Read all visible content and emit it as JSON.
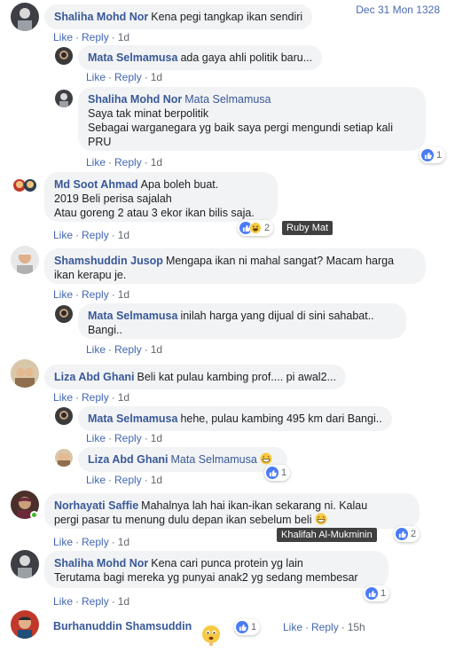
{
  "timestamp": "Dec 31 Mon 1328",
  "labels": {
    "like": "Like",
    "reply": "Reply",
    "dot": "·"
  },
  "comments": [
    {
      "author": "Shaliha Mohd Nor",
      "text": "Kena pegi tangkap ikan sendiri",
      "time": "1d"
    },
    {
      "author": "Mata Selmamusa",
      "text": "ada gaya ahli politik baru...",
      "time": "1d"
    },
    {
      "author": "Shaliha Mohd Nor",
      "mention": "Mata Selmamusa",
      "lines": [
        "Saya tak minat berpolitik",
        "Sebagai warganegara yg baik saya pergi mengundi setiap kali",
        "PRU"
      ],
      "time": "1d",
      "reaction_count": "1"
    },
    {
      "author": "Md Soot Ahmad",
      "text": "Apa boleh buat.",
      "lines": [
        "2019 Beli perisa sajalah",
        "Atau goreng 2 atau 3 ekor ikan bilis saja."
      ],
      "time": "1d",
      "reaction_count": "2",
      "hover_name": "Ruby Mat"
    },
    {
      "author": "Shamshuddin Jusop",
      "text": "Mengapa ikan ni mahal sangat? Macam harga",
      "lines": [
        "ikan kerapu je."
      ],
      "time": "1d"
    },
    {
      "author": "Mata Selmamusa",
      "text": "inilah harga yang dijual di sini sahabat..",
      "lines": [
        "Bangi.."
      ],
      "time": "1d"
    },
    {
      "author": "Liza Abd Ghani",
      "text": "Beli kat pulau kambing prof.... pi awal2...",
      "time": "1d"
    },
    {
      "author": "Mata Selmamusa",
      "text": "hehe, pulau kambing 495 km dari Bangi..",
      "time": "1d"
    },
    {
      "author": "Liza Abd Ghani",
      "mention": "Mata Selmamusa",
      "time": "1d",
      "reaction_count": "1"
    },
    {
      "author": "Norhayati Saffie",
      "text": "Mahalnya lah hai ikan-ikan sekarang ni. Kalau",
      "lines": [
        "pergi pasar tu menung dulu depan ikan sebelum beli"
      ],
      "time": "1d",
      "reaction_count": "2",
      "hover_name": "Khalifah Al-Mukminin"
    },
    {
      "author": "Shaliha Mohd Nor",
      "text": "Kena cari punca protein yg lain",
      "lines": [
        "Terutama bagi mereka yg punyai anak2 yg sedang membesar"
      ],
      "time": "1d",
      "reaction_count": "1"
    },
    {
      "author": "Burhanuddin Shamsuddin",
      "time": "15h",
      "reaction_count": "1"
    }
  ],
  "colors": {
    "link": "#385898",
    "bubble": "#f2f3f5",
    "like_blue": "#4a7bf7",
    "online": "#42b72a"
  }
}
